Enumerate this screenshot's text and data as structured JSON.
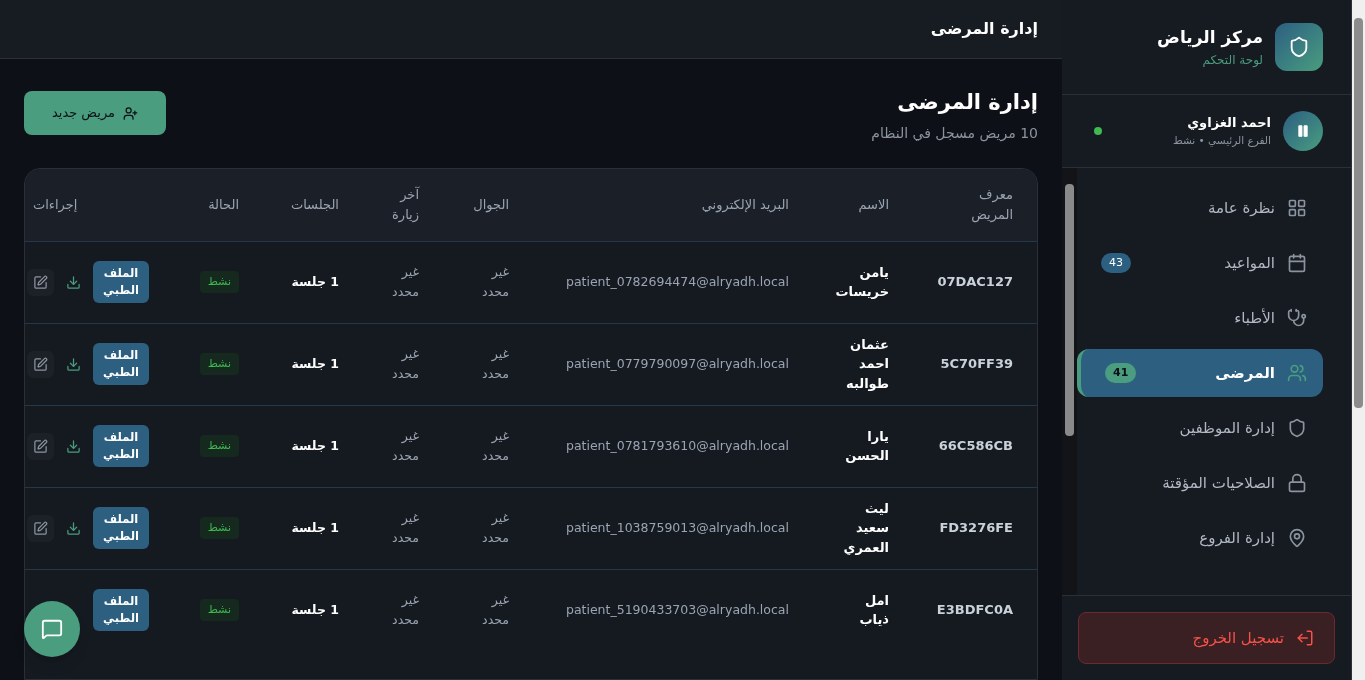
{
  "topbar": {
    "title": "إدارة المرضى"
  },
  "page": {
    "title": "إدارة المرضى",
    "subtitle": "10 مريض مسجل في النظام",
    "new_button": "مريض جديد"
  },
  "table": {
    "columns": [
      "معرف المريض",
      "الاسم",
      "البريد الإلكتروني",
      "الجوال",
      "آخر زيارة",
      "الجلسات",
      "الحالة",
      "إجراءات"
    ],
    "rows": [
      {
        "id": "07DAC127",
        "name": "يامن خريسات",
        "email": "patient_0782694474@alryadh.local",
        "phone": "غير محدد",
        "last_visit": "غير محدد",
        "sessions": "1 جلسة",
        "status": "نشط",
        "file_button": "الملف الطبي",
        "tools_visible": true
      },
      {
        "id": "5C70FF39",
        "name": "عثمان احمد طوالبه",
        "email": "patient_0779790097@alryadh.local",
        "phone": "غير محدد",
        "last_visit": "غير محدد",
        "sessions": "1 جلسة",
        "status": "نشط",
        "file_button": "الملف الطبي",
        "tools_visible": true
      },
      {
        "id": "66C586CB",
        "name": "يارا الحسن",
        "email": "patient_0781793610@alryadh.local",
        "phone": "غير محدد",
        "last_visit": "غير محدد",
        "sessions": "1 جلسة",
        "status": "نشط",
        "file_button": "الملف الطبي",
        "tools_visible": true
      },
      {
        "id": "FD3276FE",
        "name": "ليث سعيد العمري",
        "email": "patient_1038759013@alryadh.local",
        "phone": "غير محدد",
        "last_visit": "غير محدد",
        "sessions": "1 جلسة",
        "status": "نشط",
        "file_button": "الملف الطبي",
        "tools_visible": true
      },
      {
        "id": "E3BDFC0A",
        "name": "امل ذياب",
        "email": "patient_5190433703@alryadh.local",
        "phone": "غير محدد",
        "last_visit": "غير محدد",
        "sessions": "1 جلسة",
        "status": "نشط",
        "file_button": "الملف الطبي",
        "tools_visible": false
      }
    ]
  },
  "sidebar": {
    "brand": {
      "title": "مركز الرياض",
      "subtitle": "لوحة التحكم"
    },
    "user": {
      "name": "احمد الغزاوي",
      "meta": "الفرع الرئيسي • نشط",
      "online": true
    },
    "items": [
      {
        "label": "نظرة عامة",
        "selected": false
      },
      {
        "label": "المواعيد",
        "badge": "43",
        "selected": false
      },
      {
        "label": "الأطباء",
        "selected": false
      },
      {
        "label": "المرضى",
        "badge": "41",
        "selected": true
      },
      {
        "label": "إدارة الموظفين",
        "selected": false
      },
      {
        "label": "الصلاحيات المؤقتة",
        "selected": false
      },
      {
        "label": "إدارة الفروع",
        "selected": false
      }
    ],
    "logout": "تسجيل الخروج"
  }
}
